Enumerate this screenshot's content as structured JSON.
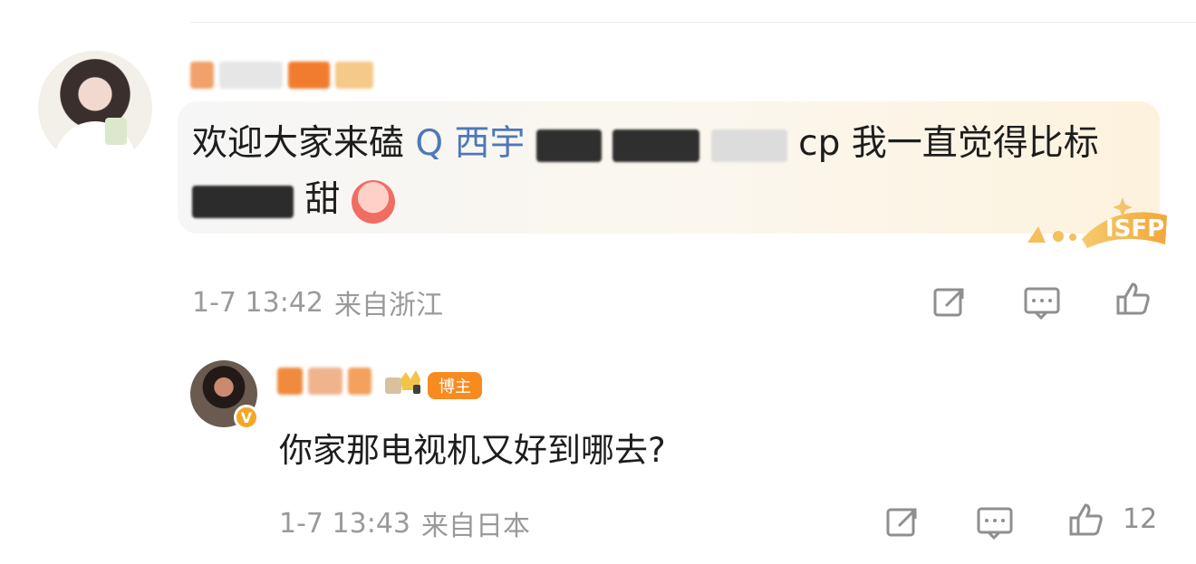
{
  "comments": [
    {
      "id": "main-comment",
      "username_masked": "",
      "content_prefix": "欢迎大家来磕",
      "topic_prefix": "Q",
      "topic_text": "西宇",
      "content_suffix": "cp 我一直觉得比标",
      "content_end": "甜",
      "meta": {
        "date": "1-7 13:42",
        "location": "来自浙江"
      },
      "badges": {
        "personality": "ISFP"
      }
    },
    {
      "id": "reply-comment",
      "username_masked": "",
      "blogger_badge": "博主",
      "content": "你家那电视机又好到哪去?",
      "meta": {
        "date": "1-7 13:43",
        "location": "来自日本"
      },
      "like_count": "12",
      "verified_mark": "V"
    }
  ],
  "icons": {
    "share": "share-icon",
    "comment": "comment-icon",
    "like": "like-icon"
  },
  "colors": {
    "accent_orange": "#f78b1f",
    "topic_blue": "#4d79b8",
    "meta_gray": "#9a9a9a"
  }
}
